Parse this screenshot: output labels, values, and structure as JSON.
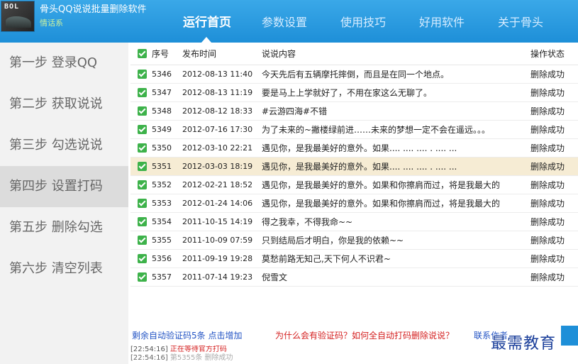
{
  "app": {
    "title": "骨头QQ说说批量删除软件",
    "subtitle": "情话系",
    "avatar_text": "BOL"
  },
  "tabs": [
    {
      "label": "运行首页",
      "active": true
    },
    {
      "label": "参数设置",
      "active": false
    },
    {
      "label": "使用技巧",
      "active": false
    },
    {
      "label": "好用软件",
      "active": false
    },
    {
      "label": "关于骨头",
      "active": false
    }
  ],
  "steps": [
    {
      "label": "第一步 登录QQ"
    },
    {
      "label": "第二步 获取说说"
    },
    {
      "label": "第三步 勾选说说"
    },
    {
      "label": "第四步 设置打码",
      "active": true
    },
    {
      "label": "第五步 删除勾选"
    },
    {
      "label": "第六步 清空列表"
    }
  ],
  "table": {
    "headers": {
      "id": "序号",
      "time": "发布时间",
      "content": "说说内容",
      "status": "操作状态"
    },
    "rows": [
      {
        "id": "5346",
        "time": "2012-08-13 11:40",
        "content": "今天先后有五辆摩托摔倒，而且是在同一个地点。",
        "status": "删除成功"
      },
      {
        "id": "5347",
        "time": "2012-08-13 11:19",
        "content": "要是马上上学就好了，不用在家这么无聊了。",
        "status": "删除成功"
      },
      {
        "id": "5348",
        "time": "2012-08-12 18:33",
        "content": "#云游四海#不错",
        "status": "删除成功"
      },
      {
        "id": "5349",
        "time": "2012-07-16 17:30",
        "content": "为了未来的~撇楼绿前进……未来的梦想一定不会在遥远。。。",
        "status": "删除成功"
      },
      {
        "id": "5350",
        "time": "2012-03-10 22:21",
        "content": "遇见你，是我最美好的意外。如果.... .... .... . .... ...",
        "status": "删除成功"
      },
      {
        "id": "5351",
        "time": "2012-03-03 18:19",
        "content": "遇见你，是我最美好的意外。如果.... .... .... . .... ...",
        "status": "删除成功",
        "selected": true
      },
      {
        "id": "5352",
        "time": "2012-02-21 18:52",
        "content": "遇见你，是我最美好的意外。如果和你擦肩而过，将是我最大的",
        "status": "删除成功"
      },
      {
        "id": "5353",
        "time": "2012-01-24 14:06",
        "content": "遇见你，是我最美好的意外。如果和你擦肩而过，将是我最大的",
        "status": "删除成功"
      },
      {
        "id": "5354",
        "time": "2011-10-15 14:19",
        "content": "得之我幸，不得我命~~",
        "status": "删除成功"
      },
      {
        "id": "5355",
        "time": "2011-10-09 07:59",
        "content": "只到结局后才明白，你是我的依赖~~",
        "status": "删除成功"
      },
      {
        "id": "5356",
        "time": "2011-09-19 19:28",
        "content": "莫愁前路无知己,天下何人不识君~",
        "status": "删除成功"
      },
      {
        "id": "5357",
        "time": "2011-07-14 19:23",
        "content": "倪雪文",
        "status": "删除成功"
      }
    ]
  },
  "footer": {
    "left": "剩余自动验证码5条 点击增加",
    "middle": "为什么会有验证码？如何全自动打码删除说说？",
    "right": "联系作者"
  },
  "log": [
    {
      "time": "[22:54:16]",
      "msg": "正在等待官方打码"
    },
    {
      "time": "[22:54:16]",
      "msg": "第5355条 删除成功"
    }
  ],
  "watermark": "最需教育",
  "colors": {
    "header": "#1e8fd8",
    "check": "#3db24a",
    "selected_row": "#f6ecd4",
    "link": "#2253c4",
    "warn": "#d41f1f"
  }
}
